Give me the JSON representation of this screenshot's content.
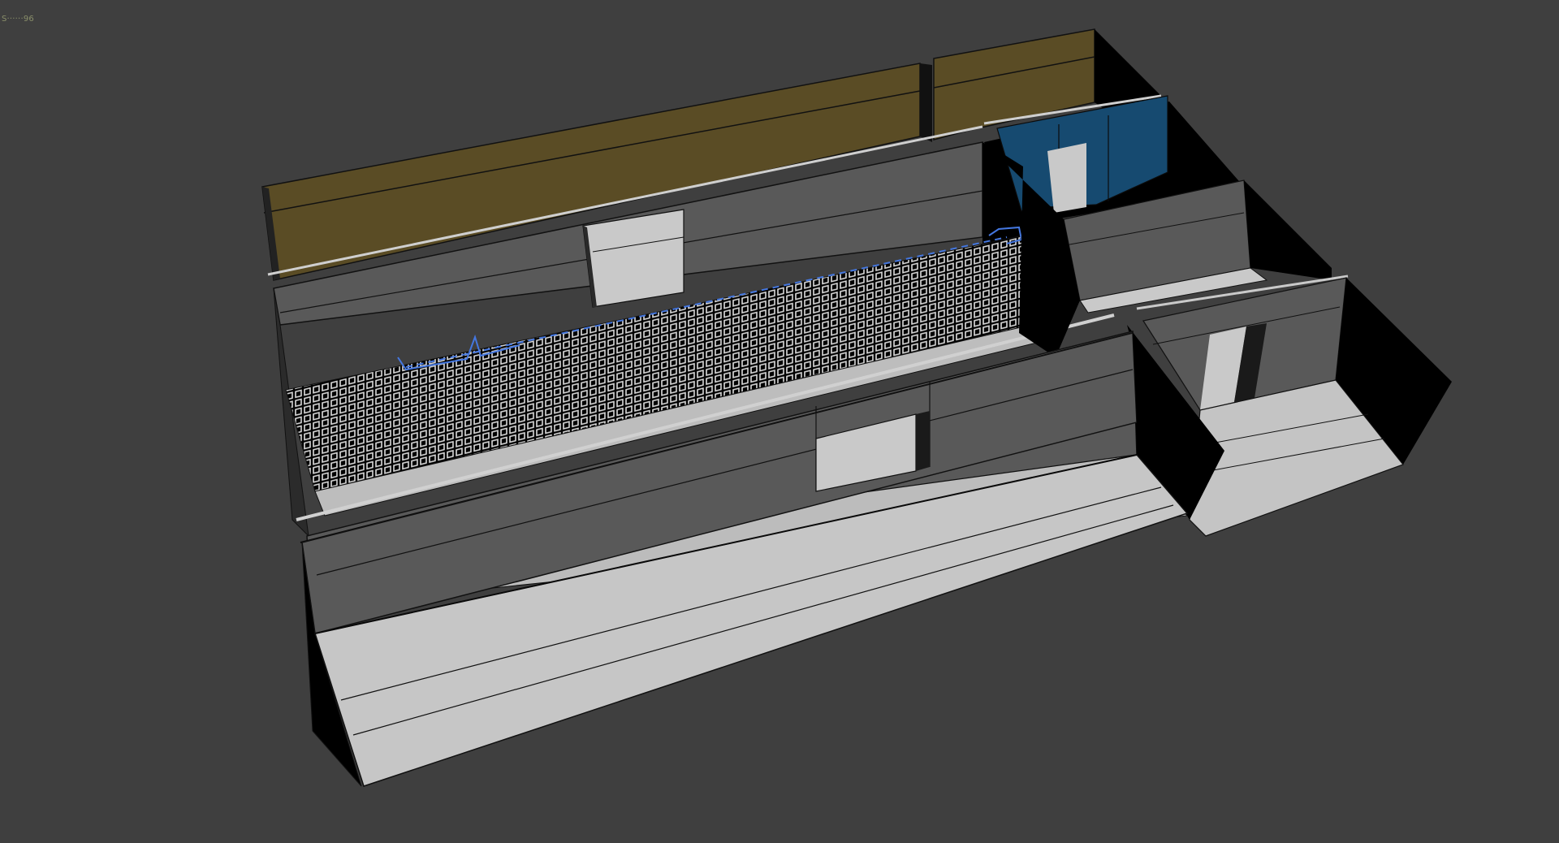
{
  "viewport": {
    "label": "S······96",
    "shading": "default-shading",
    "colors": {
      "background": "#3f3f3f",
      "wall_face": "#5a5a5a",
      "wall_dark": "#000000",
      "wall_top_edge": "#7a7a7a",
      "floor": "#c9c9c9",
      "ceiling": "#5a4c25",
      "selected_door": "#164a70",
      "grid_lines": "#d8d8d8",
      "spline_helper": "#3f6fd8"
    }
  },
  "scene": {
    "objects": [
      {
        "name": "ceiling-slab-main"
      },
      {
        "name": "ceiling-slab-right"
      },
      {
        "name": "back-wall"
      },
      {
        "name": "middle-wall-with-grid"
      },
      {
        "name": "front-wall"
      },
      {
        "name": "floor-front-room"
      },
      {
        "name": "floor-right-room"
      },
      {
        "name": "door-panel-selected"
      },
      {
        "name": "grid-mesh"
      },
      {
        "name": "spline-helper"
      }
    ]
  }
}
